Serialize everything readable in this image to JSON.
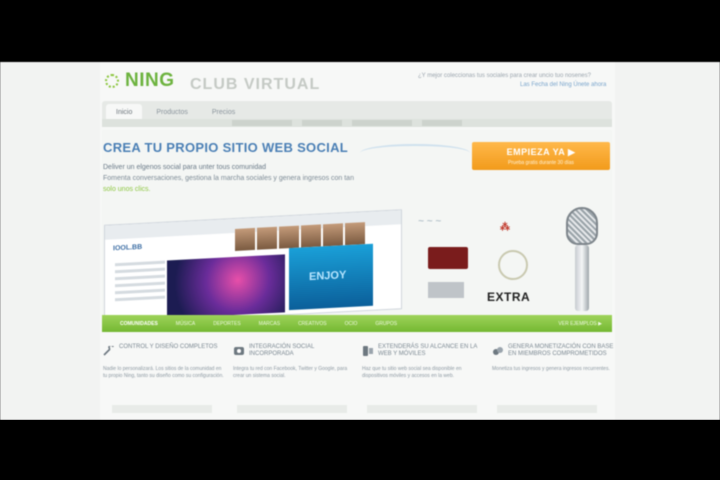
{
  "header": {
    "logo_text": "NING",
    "ghost_title": "CLUB VIRTUAL",
    "tagline": "¿Y mejor coleccionas tus sociales para crear uncio tuo nosenes?",
    "links": "Las Fecha del Ning  Únete ahora"
  },
  "nav": {
    "tabs": [
      {
        "label": "Inicio",
        "active": true
      },
      {
        "label": "Productos",
        "active": false
      },
      {
        "label": "Precios",
        "active": false
      }
    ]
  },
  "banner": {
    "title": "CREA TU PROPIO SITIO WEB SOCIAL",
    "description_line1": "Deliver un elgenos social para unter tous comunidad",
    "description_line2": "Fomenta conversaciones, gestiona la marcha sociales y genera ingresos con tan",
    "description_line3": "solo unos clics.",
    "cta_label": "EMPIEZA YA ▶",
    "cta_sub": "Prueba gratis durante 30 días"
  },
  "mockup": {
    "logo": "IOOL.BB",
    "screen_text": "ENJOY"
  },
  "side_logos": {
    "extra_label": "EXTRA"
  },
  "green_bar": {
    "tabs": [
      {
        "label": "COMUNIDADES",
        "active": true
      },
      {
        "label": "MÚSICA",
        "active": false
      },
      {
        "label": "DEPORTES",
        "active": false
      },
      {
        "label": "MARCAS",
        "active": false
      },
      {
        "label": "CREATIVOS",
        "active": false
      },
      {
        "label": "OCIO",
        "active": false
      },
      {
        "label": "GRUPOS",
        "active": false
      }
    ],
    "right_text": "VER EJEMPLOS ▶"
  },
  "features": [
    {
      "icon": "wrench-icon",
      "title": "CONTROL Y DISEÑO COMPLETOS",
      "desc": "Nadie lo personalizará. Los sitios de la comunidad en tu propio Ning, tanto su diseño como su configuración."
    },
    {
      "icon": "share-icon",
      "title": "INTEGRACIÓN SOCIAL INCORPORADA",
      "desc": "Integra tu red con Facebook, Twitter y Google, para crear un sistema social."
    },
    {
      "icon": "mobile-icon",
      "title": "EXTENDERÁS SU ALCANCE EN LA WEB Y MÓVILES",
      "desc": "Haz que tu sitio web social sea disponible en dispositivos móviles y accesos en la web."
    },
    {
      "icon": "coins-icon",
      "title": "GENERA MONETIZACIÓN CON BASE EN MIEMBROS COMPROMETIDOS",
      "desc": "Monetiza tus ingresos y genera ingresos recurrentes."
    }
  ],
  "colors": {
    "accent_green": "#8cc63f",
    "cta_orange": "#f29b1b",
    "title_blue": "#4a7fb5"
  }
}
